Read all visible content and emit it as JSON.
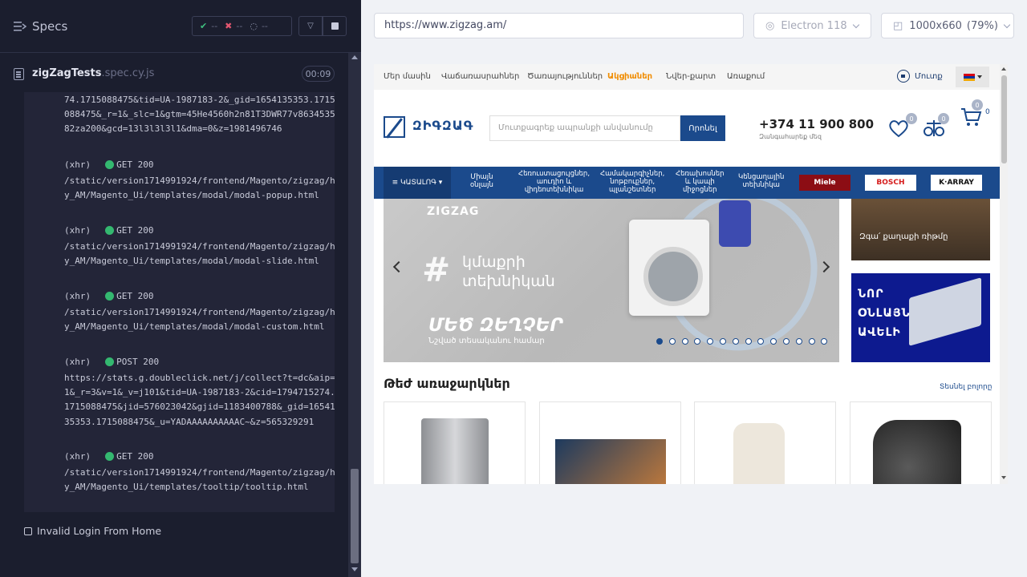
{
  "specs_panel": {
    "title": "Specs",
    "stats": {
      "passed": "--",
      "failed": "--",
      "pending": "--"
    },
    "spec_file": {
      "name": "zigZagTests",
      "ext": ".spec.cy.js",
      "duration": "00:09"
    },
    "log_fragment": "74.1715088475&tid=UA-1987183-2&_gid=1654135353.1715088475&_r=1&_slc=1&gtm=45He4560h2n81T3DWR77v863453582za200&gcd=13l3l3l3l1&dma=0&z=1981496746",
    "log_entries": [
      {
        "type": "(xhr)",
        "method": "GET 200",
        "url": "/static/version1714991924/frontend/Magento/zigzag/hy_AM/Magento_Ui/templates/modal/modal-popup.html"
      },
      {
        "type": "(xhr)",
        "method": "GET 200",
        "url": "/static/version1714991924/frontend/Magento/zigzag/hy_AM/Magento_Ui/templates/modal/modal-slide.html"
      },
      {
        "type": "(xhr)",
        "method": "GET 200",
        "url": "/static/version1714991924/frontend/Magento/zigzag/hy_AM/Magento_Ui/templates/modal/modal-custom.html"
      },
      {
        "type": "(xhr)",
        "method": "POST 200",
        "url": "https://stats.g.doubleclick.net/j/collect?t=dc&aip=1&_r=3&v=1&_v=j101&tid=UA-1987183-2&cid=1794715274.1715088475&jid=576023042&gjid=1183400788&_gid=1654135353.1715088475&_u=YADAAAAAAAAAAC~&z=565329291"
      },
      {
        "type": "(xhr)",
        "method": "GET 200",
        "url": "/static/version1714991924/frontend/Magento/zigzag/hy_AM/Magento_Ui/templates/tooltip/tooltip.html"
      }
    ],
    "next_test": "Invalid Login From Home"
  },
  "browser_bar": {
    "url": "https://www.zigzag.am/",
    "browser": "Electron 118",
    "viewport": "1000x660",
    "zoom": "(79%)"
  },
  "site": {
    "top_nav": [
      "Մեր մասին",
      "Վաճառասրահներ",
      "Ծառայություններ",
      "Ակցիաներ",
      "Նվեր-քարտ",
      "Առաքում"
    ],
    "login": "Մուտք",
    "logo_text": "ԶԻԳԶԱԳ",
    "search_placeholder": "Մուտքագրեք ապրանքի անվանումը",
    "search_button": "Որոնել",
    "phone": "+374 11 900 800",
    "phone_sub": "Զանգահարեք մեզ",
    "badges": {
      "wishlist": "0",
      "compare": "0",
      "cart": "0"
    },
    "cart_count": "0",
    "catalog": "≡ ԿԱՏԱԼՈԳ ▾",
    "nav": [
      {
        "l1": "Միայն",
        "l2": "օնլայն",
        "l3": ""
      },
      {
        "l1": "Հեռուստացույցներ,",
        "l2": "աուդիո և",
        "l3": "վիդեոտեխնիկա"
      },
      {
        "l1": "Համակարգիչներ,",
        "l2": "նոթբուքներ,",
        "l3": "պլանշետներ"
      },
      {
        "l1": "Հեռախոսներ",
        "l2": "և կապի",
        "l3": "միջոցներ"
      },
      {
        "l1": "Կենցաղային",
        "l2": "տեխնիկա",
        "l3": ""
      }
    ],
    "brands": {
      "miele": "Miele",
      "bosch": "BOSCH",
      "array": "K·ARRAY"
    },
    "hero": {
      "logo": "ZIGZAG",
      "hash": "#",
      "line1": "կմաքրի",
      "line2": "տեխնիկան",
      "big": "ՄԵԾ ԶԵՂՉԵՐ",
      "small": "Նշված տեսականու համար"
    },
    "promo1": "Զգա՛ քաղաքի ռիթմը",
    "promo2": "ՆՈՐ\nՕՆԼԱՅՆ\nԱՎԵԼԻ",
    "offers_title": "Թեժ առաջարկներ",
    "offers_link": "Տեսնել բոլորը",
    "colors": {
      "brand": "#1b4a8c",
      "sale": "#f08c00",
      "cypress_bg": "#1b1e2e"
    }
  }
}
